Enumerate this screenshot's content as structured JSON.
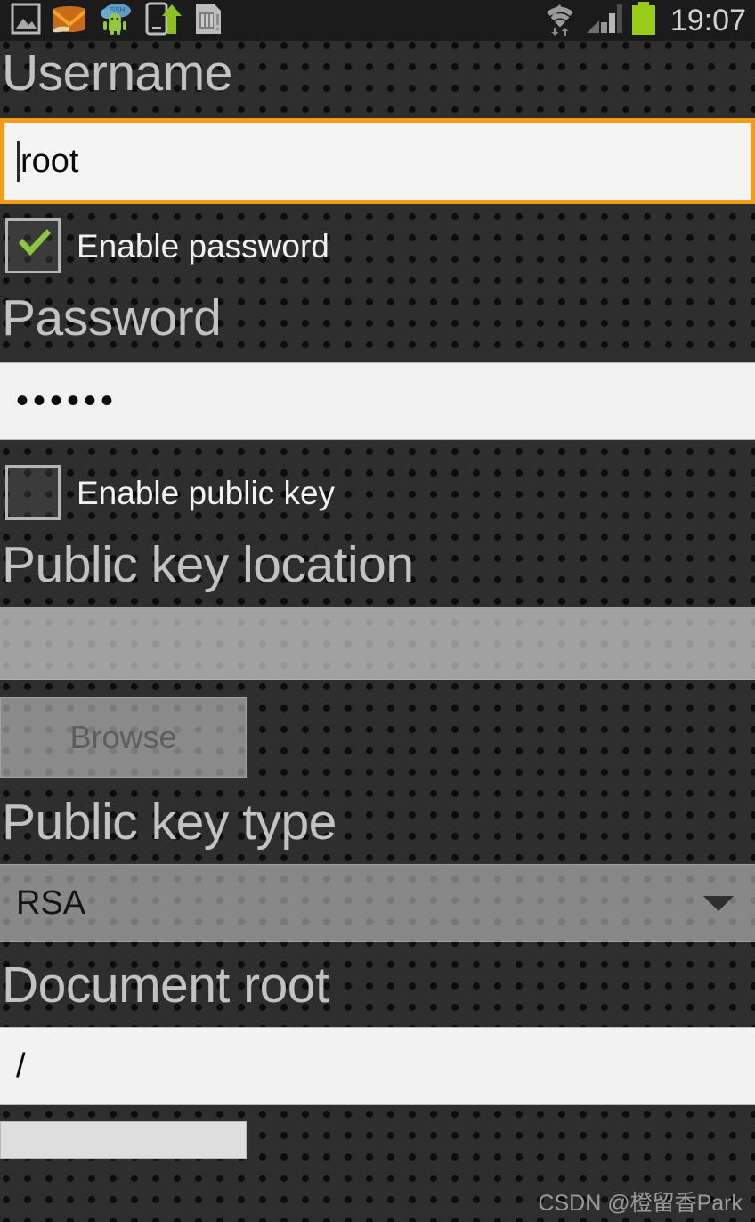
{
  "status_bar": {
    "icons": [
      {
        "name": "gallery-image-icon",
        "label": "Gallery"
      },
      {
        "name": "email-icon",
        "label": "Email"
      },
      {
        "name": "ssh-android-icon",
        "label": "SSH"
      },
      {
        "name": "usb-transfer-icon",
        "label": "USB transfer"
      },
      {
        "name": "sd-card-icon",
        "label": "SD card"
      }
    ],
    "wifi_icon": "wifi-icon",
    "signal_icon": "cellular-signal-icon",
    "battery_icon": "battery-icon",
    "clock": "19:07"
  },
  "form": {
    "username": {
      "label": "Username",
      "value": "root",
      "focused": true
    },
    "enable_password": {
      "label": "Enable password",
      "checked": true
    },
    "password": {
      "label": "Password",
      "value": "••••••",
      "masked_length": 6
    },
    "enable_public_key": {
      "label": "Enable public key",
      "checked": false
    },
    "public_key_location": {
      "label": "Public key location",
      "value": "",
      "enabled": false
    },
    "browse_button": {
      "label": "Browse",
      "enabled": false
    },
    "public_key_type": {
      "label": "Public key type",
      "value": "RSA",
      "options": [
        "RSA"
      ],
      "enabled": false
    },
    "document_root": {
      "label": "Document root",
      "value": "/"
    },
    "bottom_button": {
      "label": ""
    }
  },
  "watermark": {
    "text": "CSDN @橙留香Park"
  },
  "colors": {
    "accent_focus": "#f59c17",
    "checkbox_tick": "#8ec63f",
    "background": "#2e2e2e",
    "label_text": "#c2c2c2",
    "battery": "#97cc18"
  }
}
